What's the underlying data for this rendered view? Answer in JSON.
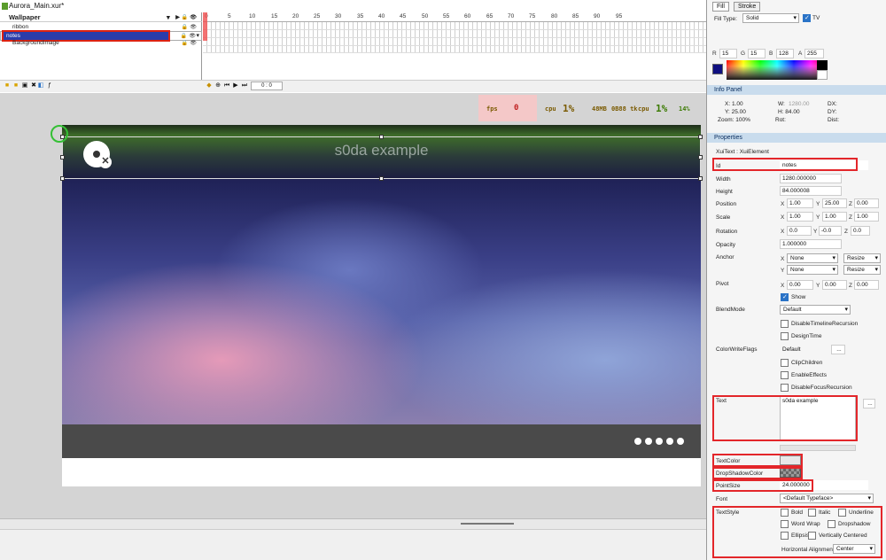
{
  "window": {
    "title": "Aurora_Main.xur*"
  },
  "timeline": {
    "root_layer": "Wallpaper",
    "layers": [
      "ribbon",
      "notes",
      "BackgroundImage"
    ],
    "selected_layer": "notes",
    "ruler_ticks": [
      "0",
      "5",
      "10",
      "15",
      "20",
      "25",
      "30",
      "35",
      "40",
      "45",
      "50",
      "55",
      "60",
      "65",
      "70",
      "75",
      "80",
      "85",
      "90",
      "95"
    ],
    "timecode": "0 : 0"
  },
  "perf": {
    "fps_label": "fps",
    "fps_value": "0",
    "cpu_label": "cpu",
    "cpu_value": "1%",
    "mem1": "48MB",
    "mem2": "0B88 tk",
    "gpu_label": "cpu",
    "gpu_value": "1%",
    "last": "14%"
  },
  "stage": {
    "notes_text": "s0da example",
    "dots": 5
  },
  "right": {
    "tabs": {
      "fill": "Fill",
      "stroke": "Stroke"
    },
    "fill_type_label": "Fill Type:",
    "fill_type": "Solid",
    "tv_label": "TV",
    "rgba": {
      "r_label": "R",
      "r": "15",
      "g_label": "G",
      "g": "15",
      "b_label": "B",
      "b": "128",
      "a_label": "A",
      "a": "255"
    },
    "swatch_color": "#0f0f80",
    "info": {
      "title": "Info Panel",
      "x": "X:   1.00",
      "y": "Y:  25.00",
      "zoom": "Zoom:   100%",
      "w": "W:",
      "w_val": "1280.00",
      "h": "H:  84.00",
      "rot": "Rot:",
      "dx": "DX:",
      "dy": "DY:",
      "dist": "Dist:"
    },
    "properties": {
      "title": "Properties",
      "class": "XuiText : XuiElement",
      "id_label": "Id",
      "id": "notes",
      "width_label": "Width",
      "width": "1280.000000",
      "height_label": "Height",
      "height": "84.000008",
      "position_label": "Position",
      "pos_x": "1.00",
      "pos_y": "25.00",
      "pos_z": "0.00",
      "scale_label": "Scale",
      "scale_x": "1.00",
      "scale_y": "1.00",
      "scale_z": "1.00",
      "rotation_label": "Rotation",
      "rot_x": "0.0",
      "rot_y": "-0.0",
      "rot_z": "0.0",
      "opacity_label": "Opacity",
      "opacity": "1.000000",
      "anchor_label": "Anchor",
      "anchor_x": "None",
      "anchor_x_r": "Resize",
      "anchor_y": "None",
      "anchor_y_r": "Resize",
      "pivot_label": "Pivot",
      "piv_x": "0.00",
      "piv_y": "0.00",
      "piv_z": "0.00",
      "show": "Show",
      "blend_label": "BlendMode",
      "blend": "Default",
      "disable_timeline": "DisableTimelineRecursion",
      "design_time": "DesignTime",
      "cwf_label": "ColorWriteFlags",
      "cwf": "Default",
      "cwf_btn": "...",
      "clip_children": "ClipChildren",
      "enable_effects": "EnableEffects",
      "disable_focus": "DisableFocusRecursion",
      "text_label": "Text",
      "text": "s0da example",
      "text_btn": "...",
      "textcolor_label": "TextColor",
      "dropshadow_label": "DropShadowColor",
      "pointsize_label": "PointSize",
      "pointsize": "24.000000",
      "font_label": "Font",
      "font": "<Default Typeface>",
      "textstyle_label": "TextStyle",
      "bold": "Bold",
      "italic": "Italic",
      "underline": "Underline",
      "wordwrap": "Word Wrap",
      "dropshadow": "Dropshadow",
      "ellipsis": "Ellipsis",
      "vcentered": "Vertically Centered",
      "halign_label": "Horizontal Alignment:",
      "halign": "Center"
    }
  }
}
